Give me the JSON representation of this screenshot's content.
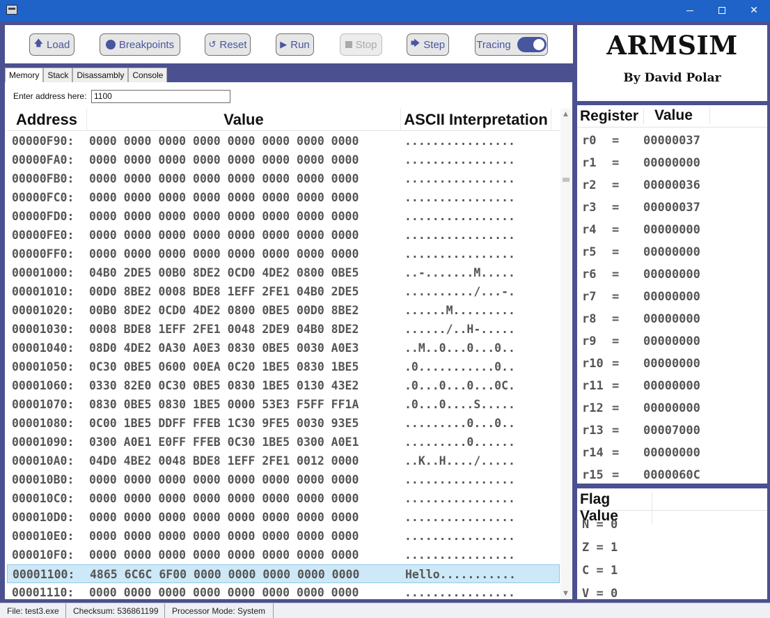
{
  "window": {
    "controls": {
      "minimize": "minimize",
      "maximize": "maximize",
      "close": "close"
    }
  },
  "toolbar": {
    "load": "Load",
    "breakpoints": "Breakpoints",
    "reset": "Reset",
    "run": "Run",
    "stop": "Stop",
    "step": "Step",
    "tracing": "Tracing",
    "tracing_on": true,
    "stop_enabled": false
  },
  "tabs": [
    "Memory",
    "Stack",
    "Disassambly",
    "Console"
  ],
  "active_tab": "Memory",
  "memory": {
    "address_label": "Enter address here:",
    "address_value": "1100",
    "headers": {
      "address": "Address",
      "value": "Value",
      "ascii": "ASCII Interpretation"
    },
    "rows": [
      {
        "addr": "00000F90:",
        "val": "0000 0000 0000 0000 0000 0000 0000 0000",
        "ascii": "................"
      },
      {
        "addr": "00000FA0:",
        "val": "0000 0000 0000 0000 0000 0000 0000 0000",
        "ascii": "................"
      },
      {
        "addr": "00000FB0:",
        "val": "0000 0000 0000 0000 0000 0000 0000 0000",
        "ascii": "................"
      },
      {
        "addr": "00000FC0:",
        "val": "0000 0000 0000 0000 0000 0000 0000 0000",
        "ascii": "................"
      },
      {
        "addr": "00000FD0:",
        "val": "0000 0000 0000 0000 0000 0000 0000 0000",
        "ascii": "................"
      },
      {
        "addr": "00000FE0:",
        "val": "0000 0000 0000 0000 0000 0000 0000 0000",
        "ascii": "................"
      },
      {
        "addr": "00000FF0:",
        "val": "0000 0000 0000 0000 0000 0000 0000 0000",
        "ascii": "................"
      },
      {
        "addr": "00001000:",
        "val": "04B0 2DE5 00B0 8DE2 0CD0 4DE2 0800 0BE5",
        "ascii": "..-.......M....."
      },
      {
        "addr": "00001010:",
        "val": "00D0 8BE2 0008 BDE8 1EFF 2FE1 04B0 2DE5",
        "ascii": "........../...-."
      },
      {
        "addr": "00001020:",
        "val": "00B0 8DE2 0CD0 4DE2 0800 0BE5 00D0 8BE2",
        "ascii": "......M........."
      },
      {
        "addr": "00001030:",
        "val": "0008 BDE8 1EFF 2FE1 0048 2DE9 04B0 8DE2",
        "ascii": "....../..H-....."
      },
      {
        "addr": "00001040:",
        "val": "08D0 4DE2 0A30 A0E3 0830 0BE5 0030 A0E3",
        "ascii": "..M..0...0...0.."
      },
      {
        "addr": "00001050:",
        "val": "0C30 0BE5 0600 00EA 0C20 1BE5 0830 1BE5",
        "ascii": ".0...........0.."
      },
      {
        "addr": "00001060:",
        "val": "0330 82E0 0C30 0BE5 0830 1BE5 0130 43E2",
        "ascii": ".0...0...0...0C."
      },
      {
        "addr": "00001070:",
        "val": "0830 0BE5 0830 1BE5 0000 53E3 F5FF FF1A",
        "ascii": ".0...0....S....."
      },
      {
        "addr": "00001080:",
        "val": "0C00 1BE5 DDFF FFEB 1C30 9FE5 0030 93E5",
        "ascii": ".........0...0.."
      },
      {
        "addr": "00001090:",
        "val": "0300 A0E1 E0FF FFEB 0C30 1BE5 0300 A0E1",
        "ascii": ".........0......"
      },
      {
        "addr": "000010A0:",
        "val": "04D0 4BE2 0048 BDE8 1EFF 2FE1 0012 0000",
        "ascii": "..K..H..../....."
      },
      {
        "addr": "000010B0:",
        "val": "0000 0000 0000 0000 0000 0000 0000 0000",
        "ascii": "................"
      },
      {
        "addr": "000010C0:",
        "val": "0000 0000 0000 0000 0000 0000 0000 0000",
        "ascii": "................"
      },
      {
        "addr": "000010D0:",
        "val": "0000 0000 0000 0000 0000 0000 0000 0000",
        "ascii": "................"
      },
      {
        "addr": "000010E0:",
        "val": "0000 0000 0000 0000 0000 0000 0000 0000",
        "ascii": "................"
      },
      {
        "addr": "000010F0:",
        "val": "0000 0000 0000 0000 0000 0000 0000 0000",
        "ascii": "................"
      },
      {
        "addr": "00001100:",
        "val": "4865 6C6C 6F00 0000 0000 0000 0000 0000",
        "ascii": "Hello...........",
        "selected": true
      },
      {
        "addr": "00001110:",
        "val": "0000 0000 0000 0000 0000 0000 0000 0000",
        "ascii": "................"
      }
    ]
  },
  "logo": {
    "title": "ARMSIM",
    "subtitle": "By David Polar"
  },
  "registers": {
    "headers": {
      "register": "Register",
      "value": "Value"
    },
    "rows": [
      {
        "name": "r0",
        "value": "00000037"
      },
      {
        "name": "r1",
        "value": "00000000"
      },
      {
        "name": "r2",
        "value": "00000036"
      },
      {
        "name": "r3",
        "value": "00000037"
      },
      {
        "name": "r4",
        "value": "00000000"
      },
      {
        "name": "r5",
        "value": "00000000"
      },
      {
        "name": "r6",
        "value": "00000000"
      },
      {
        "name": "r7",
        "value": "00000000"
      },
      {
        "name": "r8",
        "value": "00000000"
      },
      {
        "name": "r9",
        "value": "00000000"
      },
      {
        "name": "r10",
        "value": "00000000"
      },
      {
        "name": "r11",
        "value": "00000000"
      },
      {
        "name": "r12",
        "value": "00000000"
      },
      {
        "name": "r13",
        "value": "00007000"
      },
      {
        "name": "r14",
        "value": "00000000"
      },
      {
        "name": "r15",
        "value": "0000060C"
      }
    ]
  },
  "flags": {
    "header": "Flag Value",
    "rows": [
      {
        "name": "N",
        "value": "0"
      },
      {
        "name": "Z",
        "value": "1"
      },
      {
        "name": "C",
        "value": "1"
      },
      {
        "name": "V",
        "value": "0"
      }
    ]
  },
  "status": {
    "file": "File: test3.exe",
    "checksum": "Checksum: 536861199",
    "mode": "Processor Mode: System"
  },
  "colors": {
    "titlebar": "#1f63c9",
    "frame": "#4b5090",
    "accent": "#4856a0",
    "selection": "#cde8f7"
  }
}
